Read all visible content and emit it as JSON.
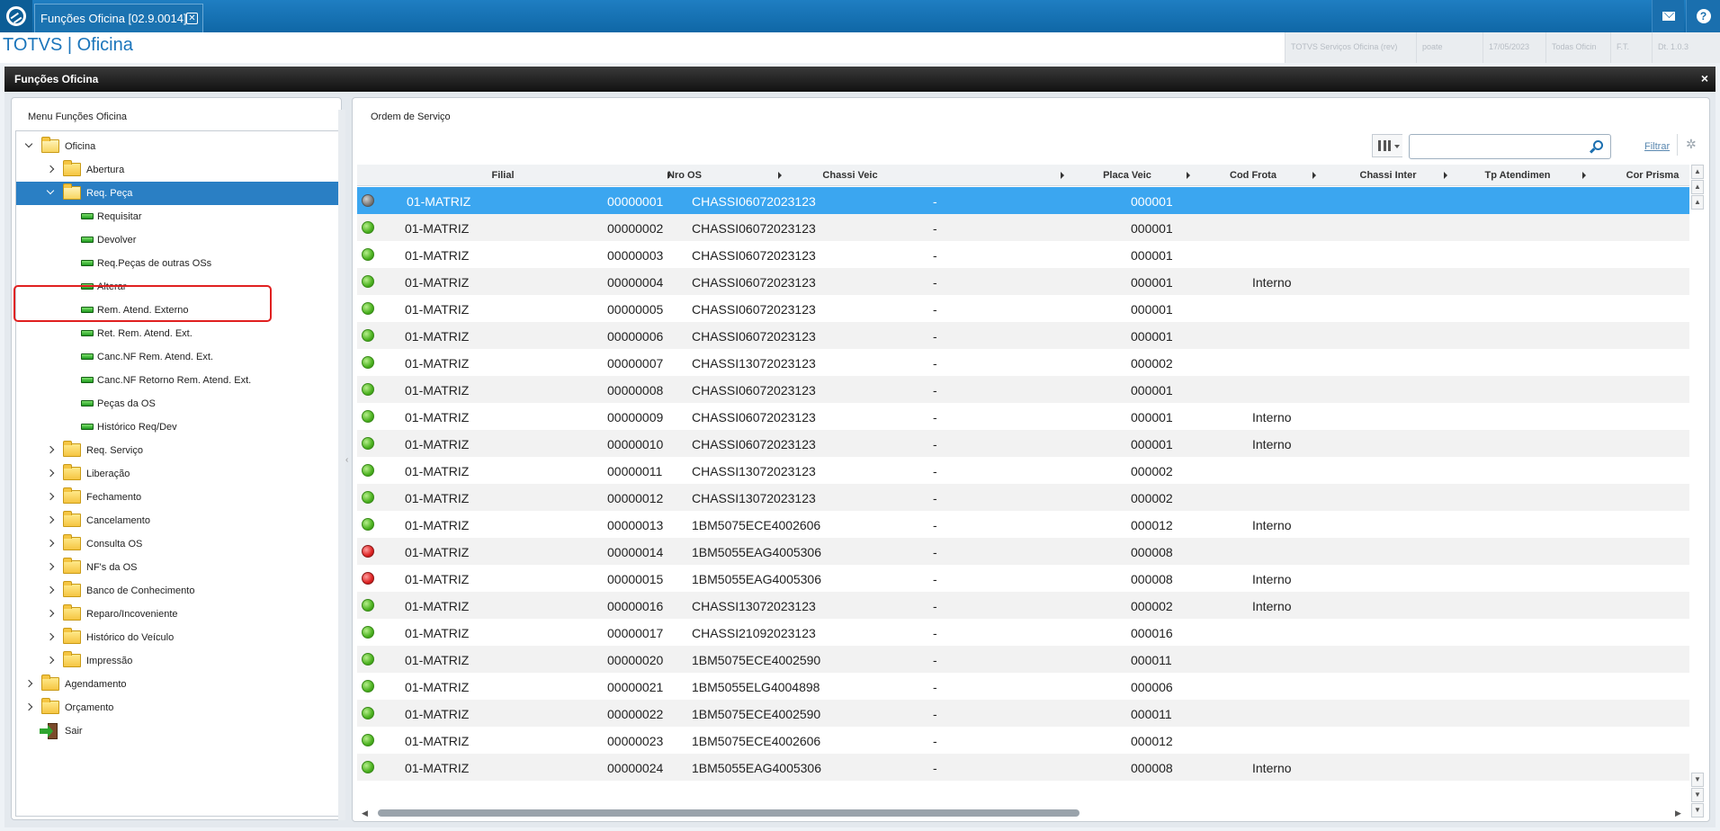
{
  "topbar": {
    "tab_label": "Funções Oficina [02.9.0014]",
    "tab_close": "✕",
    "mail_icon": "mail-icon",
    "help_icon": "?"
  },
  "app": {
    "title": "TOTVS | Oficina",
    "status_cells": [
      "TOTVS Serviços Oficina (rev)",
      "poate",
      "17/05/2023",
      "Todas Oficin",
      "F.T.",
      "Dt. 1.0.3"
    ]
  },
  "window": {
    "title": "Funções Oficina",
    "close": "×"
  },
  "menu": {
    "caption": "Menu Funções Oficina",
    "items": [
      {
        "label": "Oficina",
        "type": "folder-open",
        "caret": "down",
        "level": 0
      },
      {
        "label": "Abertura",
        "type": "folder",
        "caret": "right",
        "level": 1
      },
      {
        "label": "Req. Peça",
        "type": "folder-open",
        "caret": "down",
        "level": 1,
        "selected": true
      },
      {
        "label": "Requisitar",
        "type": "leaf",
        "level": 2
      },
      {
        "label": "Devolver",
        "type": "leaf",
        "level": 2
      },
      {
        "label": "Req.Peças de outras OSs",
        "type": "leaf",
        "level": 2
      },
      {
        "label": "Alterar",
        "type": "leaf",
        "level": 2
      },
      {
        "label": "Rem. Atend. Externo",
        "type": "leaf",
        "level": 2
      },
      {
        "label": "Ret. Rem. Atend. Ext.",
        "type": "leaf",
        "level": 2
      },
      {
        "label": "Canc.NF Rem. Atend. Ext.",
        "type": "leaf",
        "level": 2
      },
      {
        "label": "Canc.NF Retorno Rem. Atend. Ext.",
        "type": "leaf",
        "level": 2
      },
      {
        "label": "Peças da OS",
        "type": "leaf",
        "level": 2
      },
      {
        "label": "Histórico Req/Dev",
        "type": "leaf",
        "level": 2
      },
      {
        "label": "Req. Serviço",
        "type": "folder",
        "caret": "right",
        "level": 1
      },
      {
        "label": "Liberação",
        "type": "folder",
        "caret": "right",
        "level": 1
      },
      {
        "label": "Fechamento",
        "type": "folder",
        "caret": "right",
        "level": 1
      },
      {
        "label": "Cancelamento",
        "type": "folder",
        "caret": "right",
        "level": 1
      },
      {
        "label": "Consulta OS",
        "type": "folder",
        "caret": "right",
        "level": 1
      },
      {
        "label": "NF's da OS",
        "type": "folder",
        "caret": "right",
        "level": 1
      },
      {
        "label": "Banco de Conhecimento",
        "type": "folder",
        "caret": "right",
        "level": 1
      },
      {
        "label": "Reparo/Incoveniente",
        "type": "folder",
        "caret": "right",
        "level": 1
      },
      {
        "label": "Histórico do Veículo",
        "type": "folder",
        "caret": "right",
        "level": 1
      },
      {
        "label": "Impressão",
        "type": "folder",
        "caret": "right",
        "level": 1
      },
      {
        "label": "Agendamento",
        "type": "folder",
        "caret": "right",
        "level": 0
      },
      {
        "label": "Orçamento",
        "type": "folder",
        "caret": "right",
        "level": 0
      },
      {
        "label": "Sair",
        "type": "exit",
        "level": 0
      }
    ]
  },
  "grid": {
    "caption": "Ordem de Serviço",
    "search_value": "",
    "filter_label": "Filtrar",
    "gear_icon": "gear-icon",
    "columns": [
      "Filial",
      "Nro OS",
      "Chassi Veic",
      "Placa Veic",
      "Cod Frota",
      "Chassi Inter",
      "Tp Atendimen",
      "Cor Prisma"
    ],
    "rows": [
      {
        "status": "gray",
        "filial": "01-MATRIZ",
        "nro_os": "00000001",
        "chassi": "CHASSI06072023123",
        "placa": "-",
        "frota": "",
        "chassi_inter": "000001",
        "tp": "",
        "selected": true
      },
      {
        "status": "green",
        "filial": "01-MATRIZ",
        "nro_os": "00000002",
        "chassi": "CHASSI06072023123",
        "placa": "-",
        "frota": "",
        "chassi_inter": "000001",
        "tp": ""
      },
      {
        "status": "green",
        "filial": "01-MATRIZ",
        "nro_os": "00000003",
        "chassi": "CHASSI06072023123",
        "placa": "-",
        "frota": "",
        "chassi_inter": "000001",
        "tp": ""
      },
      {
        "status": "green",
        "filial": "01-MATRIZ",
        "nro_os": "00000004",
        "chassi": "CHASSI06072023123",
        "placa": "-",
        "frota": "",
        "chassi_inter": "000001",
        "tp": "Interno"
      },
      {
        "status": "green",
        "filial": "01-MATRIZ",
        "nro_os": "00000005",
        "chassi": "CHASSI06072023123",
        "placa": "-",
        "frota": "",
        "chassi_inter": "000001",
        "tp": ""
      },
      {
        "status": "green",
        "filial": "01-MATRIZ",
        "nro_os": "00000006",
        "chassi": "CHASSI06072023123",
        "placa": "-",
        "frota": "",
        "chassi_inter": "000001",
        "tp": ""
      },
      {
        "status": "green",
        "filial": "01-MATRIZ",
        "nro_os": "00000007",
        "chassi": "CHASSI13072023123",
        "placa": "-",
        "frota": "",
        "chassi_inter": "000002",
        "tp": ""
      },
      {
        "status": "green",
        "filial": "01-MATRIZ",
        "nro_os": "00000008",
        "chassi": "CHASSI06072023123",
        "placa": "-",
        "frota": "",
        "chassi_inter": "000001",
        "tp": ""
      },
      {
        "status": "green",
        "filial": "01-MATRIZ",
        "nro_os": "00000009",
        "chassi": "CHASSI06072023123",
        "placa": "-",
        "frota": "",
        "chassi_inter": "000001",
        "tp": "Interno"
      },
      {
        "status": "green",
        "filial": "01-MATRIZ",
        "nro_os": "00000010",
        "chassi": "CHASSI06072023123",
        "placa": "-",
        "frota": "",
        "chassi_inter": "000001",
        "tp": "Interno"
      },
      {
        "status": "green",
        "filial": "01-MATRIZ",
        "nro_os": "00000011",
        "chassi": "CHASSI13072023123",
        "placa": "-",
        "frota": "",
        "chassi_inter": "000002",
        "tp": ""
      },
      {
        "status": "green",
        "filial": "01-MATRIZ",
        "nro_os": "00000012",
        "chassi": "CHASSI13072023123",
        "placa": "-",
        "frota": "",
        "chassi_inter": "000002",
        "tp": ""
      },
      {
        "status": "green",
        "filial": "01-MATRIZ",
        "nro_os": "00000013",
        "chassi": "1BM5075ECE4002606",
        "placa": "-",
        "frota": "",
        "chassi_inter": "000012",
        "tp": "Interno"
      },
      {
        "status": "red",
        "filial": "01-MATRIZ",
        "nro_os": "00000014",
        "chassi": "1BM5055EAG4005306",
        "placa": "-",
        "frota": "",
        "chassi_inter": "000008",
        "tp": ""
      },
      {
        "status": "red",
        "filial": "01-MATRIZ",
        "nro_os": "00000015",
        "chassi": "1BM5055EAG4005306",
        "placa": "-",
        "frota": "",
        "chassi_inter": "000008",
        "tp": "Interno"
      },
      {
        "status": "green",
        "filial": "01-MATRIZ",
        "nro_os": "00000016",
        "chassi": "CHASSI13072023123",
        "placa": "-",
        "frota": "",
        "chassi_inter": "000002",
        "tp": "Interno"
      },
      {
        "status": "green",
        "filial": "01-MATRIZ",
        "nro_os": "00000017",
        "chassi": "CHASSI21092023123",
        "placa": "-",
        "frota": "",
        "chassi_inter": "000016",
        "tp": ""
      },
      {
        "status": "green",
        "filial": "01-MATRIZ",
        "nro_os": "00000020",
        "chassi": "1BM5075ECE4002590",
        "placa": "-",
        "frota": "",
        "chassi_inter": "000011",
        "tp": ""
      },
      {
        "status": "green",
        "filial": "01-MATRIZ",
        "nro_os": "00000021",
        "chassi": "1BM5055ELG4004898",
        "placa": "-",
        "frota": "",
        "chassi_inter": "000006",
        "tp": ""
      },
      {
        "status": "green",
        "filial": "01-MATRIZ",
        "nro_os": "00000022",
        "chassi": "1BM5075ECE4002590",
        "placa": "-",
        "frota": "",
        "chassi_inter": "000011",
        "tp": ""
      },
      {
        "status": "green",
        "filial": "01-MATRIZ",
        "nro_os": "00000023",
        "chassi": "1BM5075ECE4002606",
        "placa": "-",
        "frota": "",
        "chassi_inter": "000012",
        "tp": ""
      },
      {
        "status": "green",
        "filial": "01-MATRIZ",
        "nro_os": "00000024",
        "chassi": "1BM5055EAG4005306",
        "placa": "-",
        "frota": "",
        "chassi_inter": "000008",
        "tp": "Interno"
      }
    ]
  }
}
